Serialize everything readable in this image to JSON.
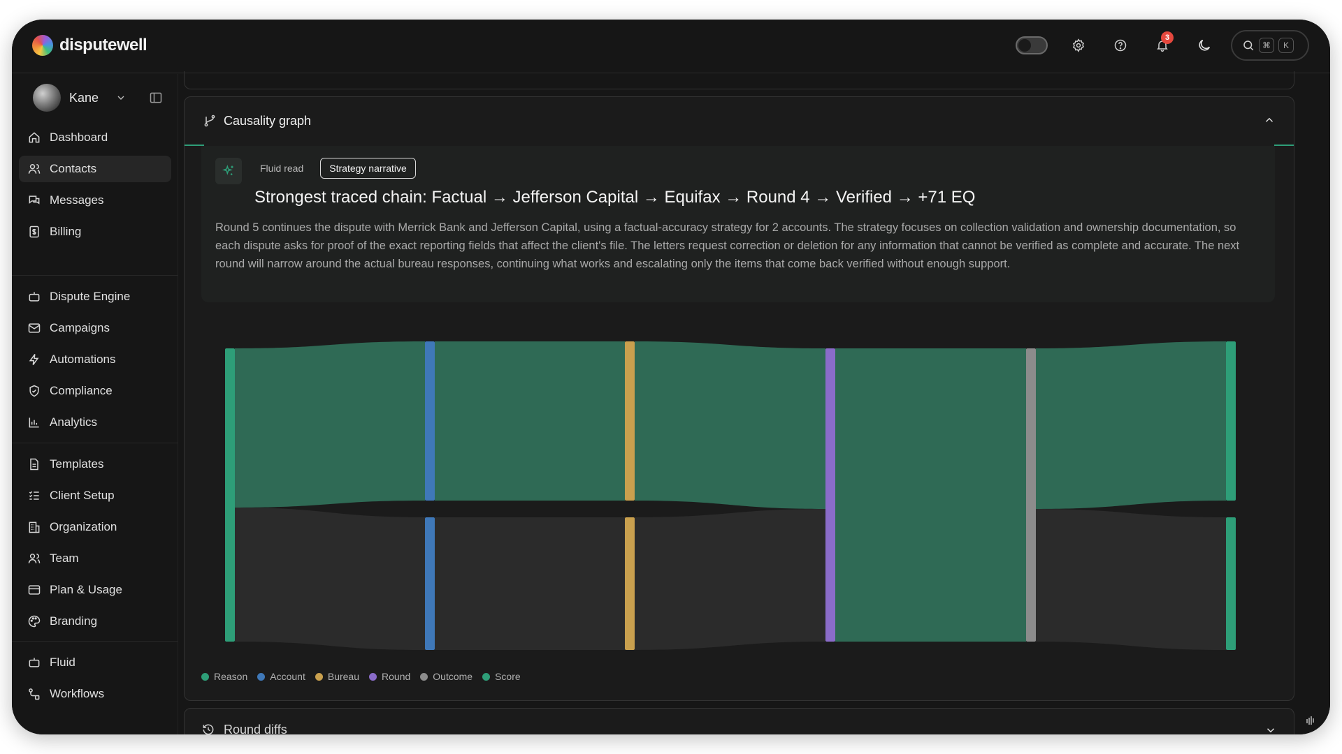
{
  "app": {
    "name": "disputewell"
  },
  "topbar": {
    "notification_count": "3",
    "kbd_cmd": "⌘",
    "kbd_k": "K"
  },
  "user": {
    "name": "Kane"
  },
  "sidebar": {
    "group1": [
      {
        "label": "Dashboard",
        "icon": "home-icon"
      },
      {
        "label": "Contacts",
        "icon": "users-icon",
        "active": true
      },
      {
        "label": "Messages",
        "icon": "messages-icon"
      },
      {
        "label": "Billing",
        "icon": "billing-icon"
      }
    ],
    "group2": [
      {
        "label": "Dispute Engine",
        "icon": "robot-icon"
      },
      {
        "label": "Campaigns",
        "icon": "mail-icon"
      },
      {
        "label": "Automations",
        "icon": "bolt-icon"
      },
      {
        "label": "Compliance",
        "icon": "shield-icon"
      },
      {
        "label": "Analytics",
        "icon": "bar-chart-icon"
      }
    ],
    "group3": [
      {
        "label": "Templates",
        "icon": "document-icon"
      },
      {
        "label": "Client Setup",
        "icon": "checklist-icon"
      },
      {
        "label": "Organization",
        "icon": "building-icon"
      },
      {
        "label": "Team",
        "icon": "team-icon"
      },
      {
        "label": "Plan & Usage",
        "icon": "card-icon"
      },
      {
        "label": "Branding",
        "icon": "palette-icon"
      }
    ],
    "group4": [
      {
        "label": "Fluid",
        "icon": "robot-icon"
      },
      {
        "label": "Workflows",
        "icon": "workflow-icon"
      }
    ]
  },
  "causality": {
    "title": "Causality graph",
    "tabs": [
      "Fluid read",
      "Strategy narrative"
    ],
    "active_tab": "Strategy narrative",
    "headline": "Strongest traced chain: Factual → Jefferson Capital → Equifax → Round 4 → Verified → +71 EQ",
    "paragraph": "Round 5 continues the dispute with Merrick Bank and Jefferson Capital, using a factual-accuracy strategy for 2 accounts. The strategy focuses on collection validation and ownership documentation, so each dispute asks for proof of the exact reporting fields that affect the client's file. The letters request correction or deletion for any information that cannot be verified as complete and accurate. The next round will narrow around the actual bureau responses, continuing what works and escalating only the items that come back verified without enough support."
  },
  "legend": [
    {
      "label": "Reason",
      "color": "#2e9e78"
    },
    {
      "label": "Account",
      "color": "#3f78b8"
    },
    {
      "label": "Bureau",
      "color": "#c9a04e"
    },
    {
      "label": "Round",
      "color": "#8a6cc9"
    },
    {
      "label": "Outcome",
      "color": "#8c8c8c"
    },
    {
      "label": "Score",
      "color": "#2e9e78"
    }
  ],
  "colors": {
    "highlight_flow": "#2f6a55",
    "dim_flow": "#2b2b2b",
    "accent": "#2e9e78"
  },
  "round_diffs": {
    "title": "Round diffs"
  }
}
